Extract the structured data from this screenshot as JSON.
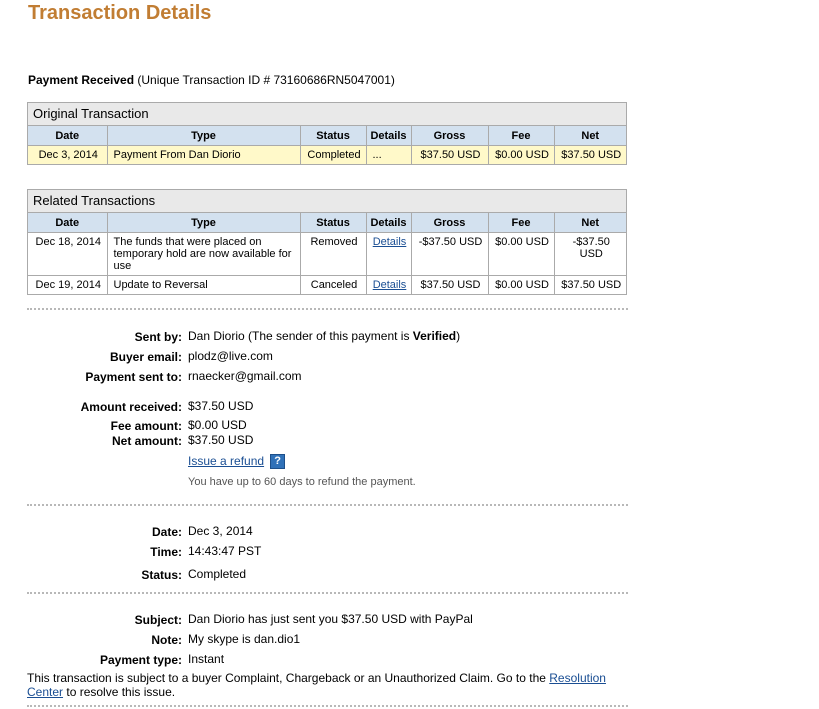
{
  "page": {
    "title": "Transaction Details",
    "subheading_bold": "Payment Received",
    "subheading_rest": " (Unique Transaction ID # 73160686RN5047001)"
  },
  "original_transaction": {
    "caption": "Original Transaction",
    "columns": [
      "Date",
      "Type",
      "Status",
      "Details",
      "Gross",
      "Fee",
      "Net"
    ],
    "rows": [
      {
        "date": "Dec 3, 2014",
        "type": "Payment From Dan Diorio",
        "status": "Completed",
        "details": "...",
        "gross": "$37.50 USD",
        "fee": "$0.00 USD",
        "net": "$37.50 USD"
      }
    ]
  },
  "related_transactions": {
    "caption": "Related Transactions",
    "columns": [
      "Date",
      "Type",
      "Status",
      "Details",
      "Gross",
      "Fee",
      "Net"
    ],
    "rows": [
      {
        "date": "Dec 18, 2014",
        "type": "The funds that were placed on temporary hold are now available for use",
        "status": "Removed",
        "details": "Details",
        "gross": "-$37.50 USD",
        "fee": "$0.00 USD",
        "net": "-$37.50 USD"
      },
      {
        "date": "Dec 19, 2014",
        "type": "Update to Reversal",
        "status": "Canceled",
        "details": "Details",
        "gross": "$37.50 USD",
        "fee": "$0.00 USD",
        "net": "$37.50 USD"
      }
    ]
  },
  "payment": {
    "sent_by_label": "Sent by:",
    "sent_by_name": "Dan Diorio",
    "sent_by_note_pre": " (The sender of this payment is ",
    "sent_by_note_bold": "Verified",
    "sent_by_note_post": ")",
    "buyer_email_label": "Buyer email:",
    "buyer_email": "plodz@live.com",
    "sent_to_label": "Payment sent to:",
    "sent_to": "rnaecker@gmail.com",
    "amount_label": "Amount received:",
    "amount": "$37.50 USD",
    "fee_label": "Fee amount:",
    "fee": "$0.00 USD",
    "net_label": "Net amount:",
    "net": "$37.50 USD",
    "refund_link": "Issue a refund",
    "help_icon": "?",
    "refund_note": "You have up to 60 days to refund the payment."
  },
  "timing": {
    "date_label": "Date:",
    "date": "Dec 3, 2014",
    "time_label": "Time:",
    "time": "14:43:47 PST",
    "status_label": "Status:",
    "status": "Completed"
  },
  "message": {
    "subject_label": "Subject:",
    "subject": "Dan Diorio has just sent you $37.50 USD with PayPal",
    "note_label": "Note:",
    "note": "My skype is dan.dio1",
    "type_label": "Payment type:",
    "type": "Instant"
  },
  "footer": {
    "text_pre": "This transaction is subject to a buyer Complaint, Chargeback or an Unauthorized Claim. Go to the ",
    "link": "Resolution Center",
    "text_post": " to resolve this issue."
  }
}
